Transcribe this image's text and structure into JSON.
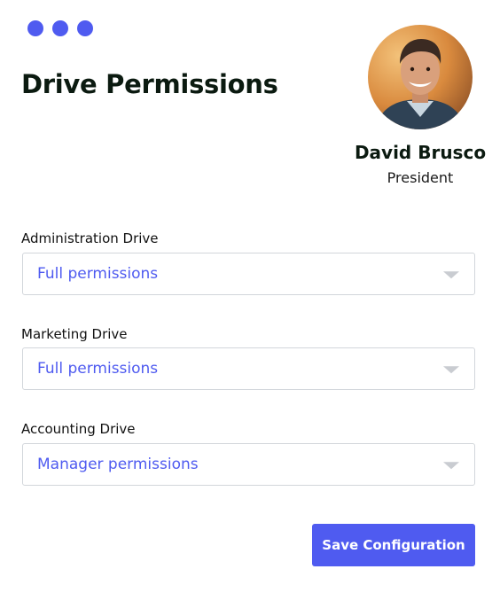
{
  "window": {
    "dots": [
      "dot-1",
      "dot-2",
      "dot-3"
    ],
    "dot_color": "#4f5bf0"
  },
  "page": {
    "title": "Drive Permissions"
  },
  "profile": {
    "name": "David Brusco",
    "role": "President"
  },
  "drives": [
    {
      "label": "Administration Drive",
      "value": "Full permissions"
    },
    {
      "label": "Marketing Drive",
      "value": "Full permissions"
    },
    {
      "label": "Accounting Drive",
      "value": "Manager permissions"
    }
  ],
  "actions": {
    "save_label": "Save Configuration"
  },
  "colors": {
    "accent": "#4f5bf0",
    "title": "#0b1a10",
    "border": "#d2d6db"
  }
}
